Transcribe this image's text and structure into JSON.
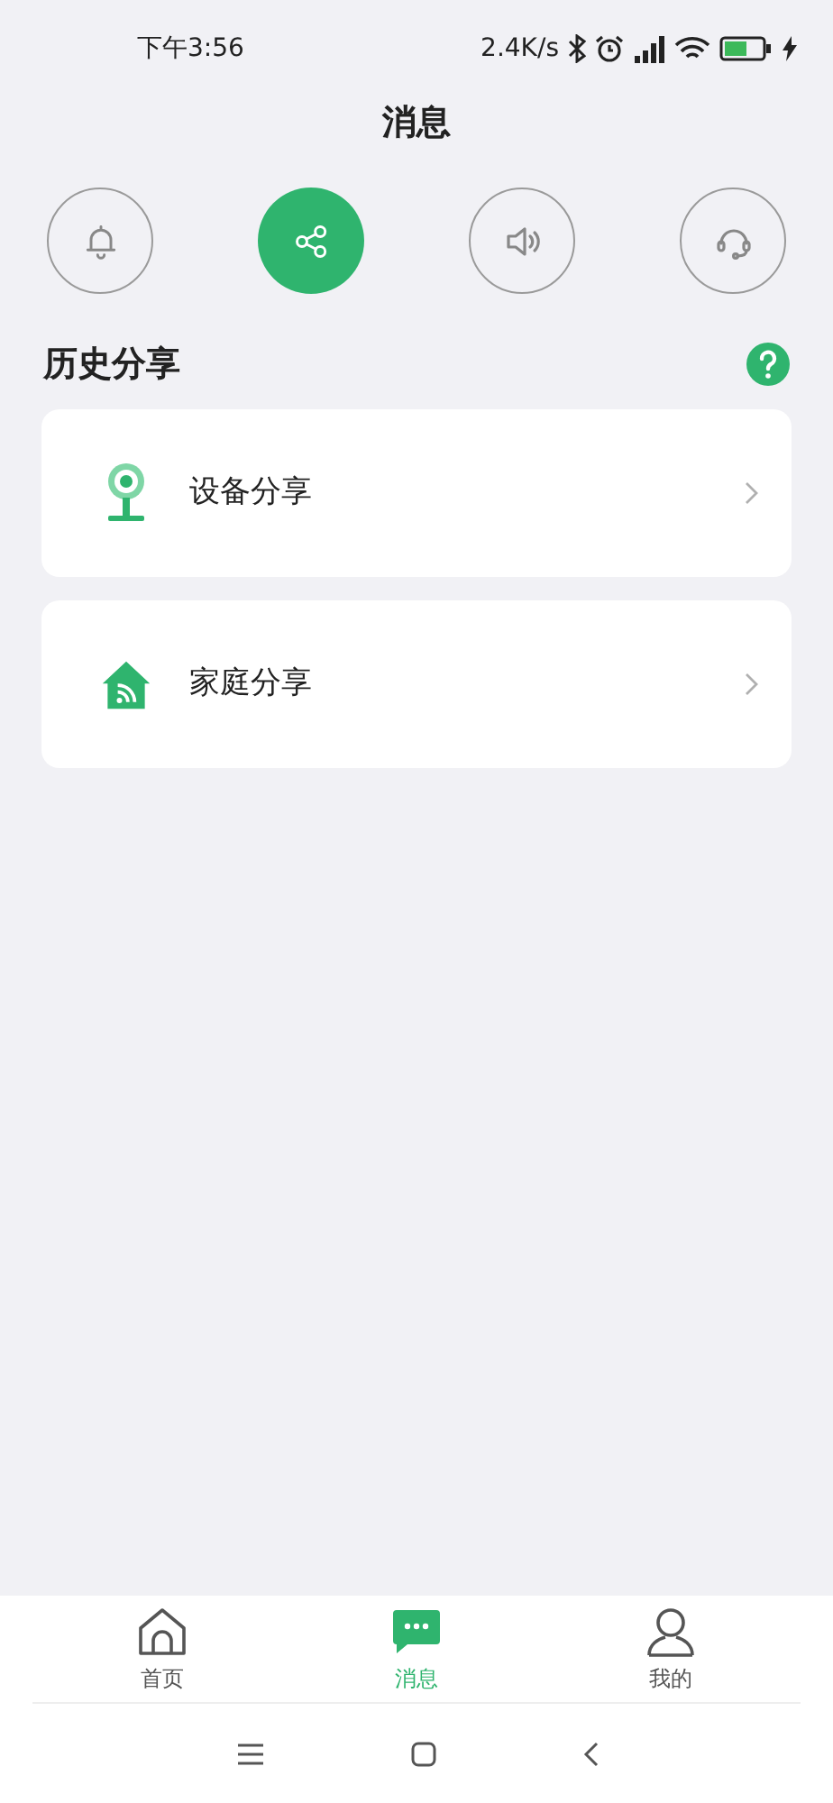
{
  "status_bar": {
    "time": "下午3:56",
    "speed": "2.4K/s"
  },
  "title": "消息",
  "categories": [
    {
      "kind": "bell",
      "selected": false
    },
    {
      "kind": "share",
      "selected": true
    },
    {
      "kind": "speaker",
      "selected": false
    },
    {
      "kind": "headset",
      "selected": false
    }
  ],
  "section": {
    "title": "历史分享"
  },
  "items": [
    {
      "kind": "camera",
      "label": "设备分享"
    },
    {
      "kind": "house",
      "label": "家庭分享"
    }
  ],
  "tabs": [
    {
      "kind": "home",
      "label": "首页",
      "selected": false
    },
    {
      "kind": "chat",
      "label": "消息",
      "selected": true
    },
    {
      "kind": "person",
      "label": "我的",
      "selected": false
    }
  ]
}
